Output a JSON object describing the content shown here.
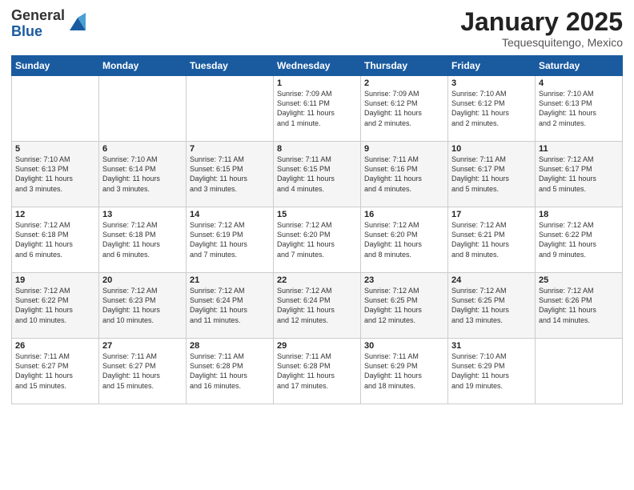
{
  "logo": {
    "general": "General",
    "blue": "Blue"
  },
  "title": "January 2025",
  "location": "Tequesquitengo, Mexico",
  "days_of_week": [
    "Sunday",
    "Monday",
    "Tuesday",
    "Wednesday",
    "Thursday",
    "Friday",
    "Saturday"
  ],
  "weeks": [
    [
      {
        "day": "",
        "info": ""
      },
      {
        "day": "",
        "info": ""
      },
      {
        "day": "",
        "info": ""
      },
      {
        "day": "1",
        "info": "Sunrise: 7:09 AM\nSunset: 6:11 PM\nDaylight: 11 hours\nand 1 minute."
      },
      {
        "day": "2",
        "info": "Sunrise: 7:09 AM\nSunset: 6:12 PM\nDaylight: 11 hours\nand 2 minutes."
      },
      {
        "day": "3",
        "info": "Sunrise: 7:10 AM\nSunset: 6:12 PM\nDaylight: 11 hours\nand 2 minutes."
      },
      {
        "day": "4",
        "info": "Sunrise: 7:10 AM\nSunset: 6:13 PM\nDaylight: 11 hours\nand 2 minutes."
      }
    ],
    [
      {
        "day": "5",
        "info": "Sunrise: 7:10 AM\nSunset: 6:13 PM\nDaylight: 11 hours\nand 3 minutes."
      },
      {
        "day": "6",
        "info": "Sunrise: 7:10 AM\nSunset: 6:14 PM\nDaylight: 11 hours\nand 3 minutes."
      },
      {
        "day": "7",
        "info": "Sunrise: 7:11 AM\nSunset: 6:15 PM\nDaylight: 11 hours\nand 3 minutes."
      },
      {
        "day": "8",
        "info": "Sunrise: 7:11 AM\nSunset: 6:15 PM\nDaylight: 11 hours\nand 4 minutes."
      },
      {
        "day": "9",
        "info": "Sunrise: 7:11 AM\nSunset: 6:16 PM\nDaylight: 11 hours\nand 4 minutes."
      },
      {
        "day": "10",
        "info": "Sunrise: 7:11 AM\nSunset: 6:17 PM\nDaylight: 11 hours\nand 5 minutes."
      },
      {
        "day": "11",
        "info": "Sunrise: 7:12 AM\nSunset: 6:17 PM\nDaylight: 11 hours\nand 5 minutes."
      }
    ],
    [
      {
        "day": "12",
        "info": "Sunrise: 7:12 AM\nSunset: 6:18 PM\nDaylight: 11 hours\nand 6 minutes."
      },
      {
        "day": "13",
        "info": "Sunrise: 7:12 AM\nSunset: 6:18 PM\nDaylight: 11 hours\nand 6 minutes."
      },
      {
        "day": "14",
        "info": "Sunrise: 7:12 AM\nSunset: 6:19 PM\nDaylight: 11 hours\nand 7 minutes."
      },
      {
        "day": "15",
        "info": "Sunrise: 7:12 AM\nSunset: 6:20 PM\nDaylight: 11 hours\nand 7 minutes."
      },
      {
        "day": "16",
        "info": "Sunrise: 7:12 AM\nSunset: 6:20 PM\nDaylight: 11 hours\nand 8 minutes."
      },
      {
        "day": "17",
        "info": "Sunrise: 7:12 AM\nSunset: 6:21 PM\nDaylight: 11 hours\nand 8 minutes."
      },
      {
        "day": "18",
        "info": "Sunrise: 7:12 AM\nSunset: 6:22 PM\nDaylight: 11 hours\nand 9 minutes."
      }
    ],
    [
      {
        "day": "19",
        "info": "Sunrise: 7:12 AM\nSunset: 6:22 PM\nDaylight: 11 hours\nand 10 minutes."
      },
      {
        "day": "20",
        "info": "Sunrise: 7:12 AM\nSunset: 6:23 PM\nDaylight: 11 hours\nand 10 minutes."
      },
      {
        "day": "21",
        "info": "Sunrise: 7:12 AM\nSunset: 6:24 PM\nDaylight: 11 hours\nand 11 minutes."
      },
      {
        "day": "22",
        "info": "Sunrise: 7:12 AM\nSunset: 6:24 PM\nDaylight: 11 hours\nand 12 minutes."
      },
      {
        "day": "23",
        "info": "Sunrise: 7:12 AM\nSunset: 6:25 PM\nDaylight: 11 hours\nand 12 minutes."
      },
      {
        "day": "24",
        "info": "Sunrise: 7:12 AM\nSunset: 6:25 PM\nDaylight: 11 hours\nand 13 minutes."
      },
      {
        "day": "25",
        "info": "Sunrise: 7:12 AM\nSunset: 6:26 PM\nDaylight: 11 hours\nand 14 minutes."
      }
    ],
    [
      {
        "day": "26",
        "info": "Sunrise: 7:11 AM\nSunset: 6:27 PM\nDaylight: 11 hours\nand 15 minutes."
      },
      {
        "day": "27",
        "info": "Sunrise: 7:11 AM\nSunset: 6:27 PM\nDaylight: 11 hours\nand 15 minutes."
      },
      {
        "day": "28",
        "info": "Sunrise: 7:11 AM\nSunset: 6:28 PM\nDaylight: 11 hours\nand 16 minutes."
      },
      {
        "day": "29",
        "info": "Sunrise: 7:11 AM\nSunset: 6:28 PM\nDaylight: 11 hours\nand 17 minutes."
      },
      {
        "day": "30",
        "info": "Sunrise: 7:11 AM\nSunset: 6:29 PM\nDaylight: 11 hours\nand 18 minutes."
      },
      {
        "day": "31",
        "info": "Sunrise: 7:10 AM\nSunset: 6:29 PM\nDaylight: 11 hours\nand 19 minutes."
      },
      {
        "day": "",
        "info": ""
      }
    ]
  ]
}
